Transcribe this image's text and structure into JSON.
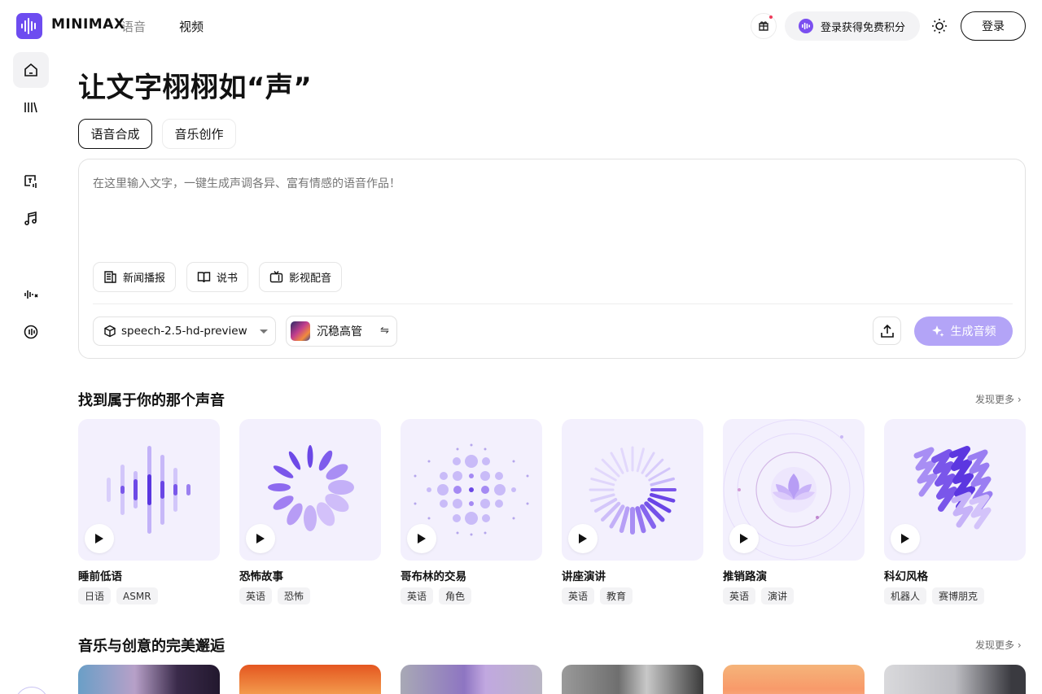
{
  "header": {
    "logo_text": "MINIMAX",
    "nav": [
      {
        "label": "语音"
      },
      {
        "label": "视频"
      }
    ],
    "credit_label": "登录获得免费积分",
    "login_label": "登录",
    "notification_dot_color": "#ef3b5a",
    "accent_color": "#6d4cf0"
  },
  "sidebar": {
    "items": [
      {
        "icon": "home-icon",
        "active": true
      },
      {
        "icon": "library-icon"
      },
      {
        "icon": "text-to-speech-icon"
      },
      {
        "icon": "music-note-icon"
      },
      {
        "icon": "voice-clone-icon"
      },
      {
        "icon": "voice-design-icon"
      }
    ]
  },
  "main": {
    "title": "让文字栩栩如“声”",
    "tabs": [
      {
        "label": "语音合成",
        "active": true
      },
      {
        "label": "音乐创作"
      }
    ],
    "editor": {
      "placeholder": "在这里输入文字，一键生成声调各异、富有情感的语音作品！",
      "chips": [
        {
          "label": "新闻播报",
          "icon": "news-icon"
        },
        {
          "label": "说书",
          "icon": "book-icon"
        },
        {
          "label": "影视配音",
          "icon": "tv-icon"
        }
      ],
      "model": "speech-2.5-hd-preview",
      "voice": "沉稳高管",
      "voice_swap_glyph": "⇋",
      "generate_label": "生成音频"
    },
    "voices_section": {
      "title": "找到属于你的那个声音",
      "more_label": "发现更多",
      "cards": [
        {
          "name": "睡前低语",
          "tags": [
            "日语",
            "ASMR"
          ]
        },
        {
          "name": "恐怖故事",
          "tags": [
            "英语",
            "恐怖"
          ]
        },
        {
          "name": "哥布林的交易",
          "tags": [
            "英语",
            "角色"
          ]
        },
        {
          "name": "讲座演讲",
          "tags": [
            "英语",
            "教育"
          ]
        },
        {
          "name": "推销路演",
          "tags": [
            "英语",
            "演讲"
          ]
        },
        {
          "name": "科幻风格",
          "tags": [
            "机器人",
            "赛博朋克"
          ]
        }
      ]
    },
    "music_section": {
      "title": "音乐与创意的完美邂逅",
      "more_label": "发现更多"
    }
  }
}
